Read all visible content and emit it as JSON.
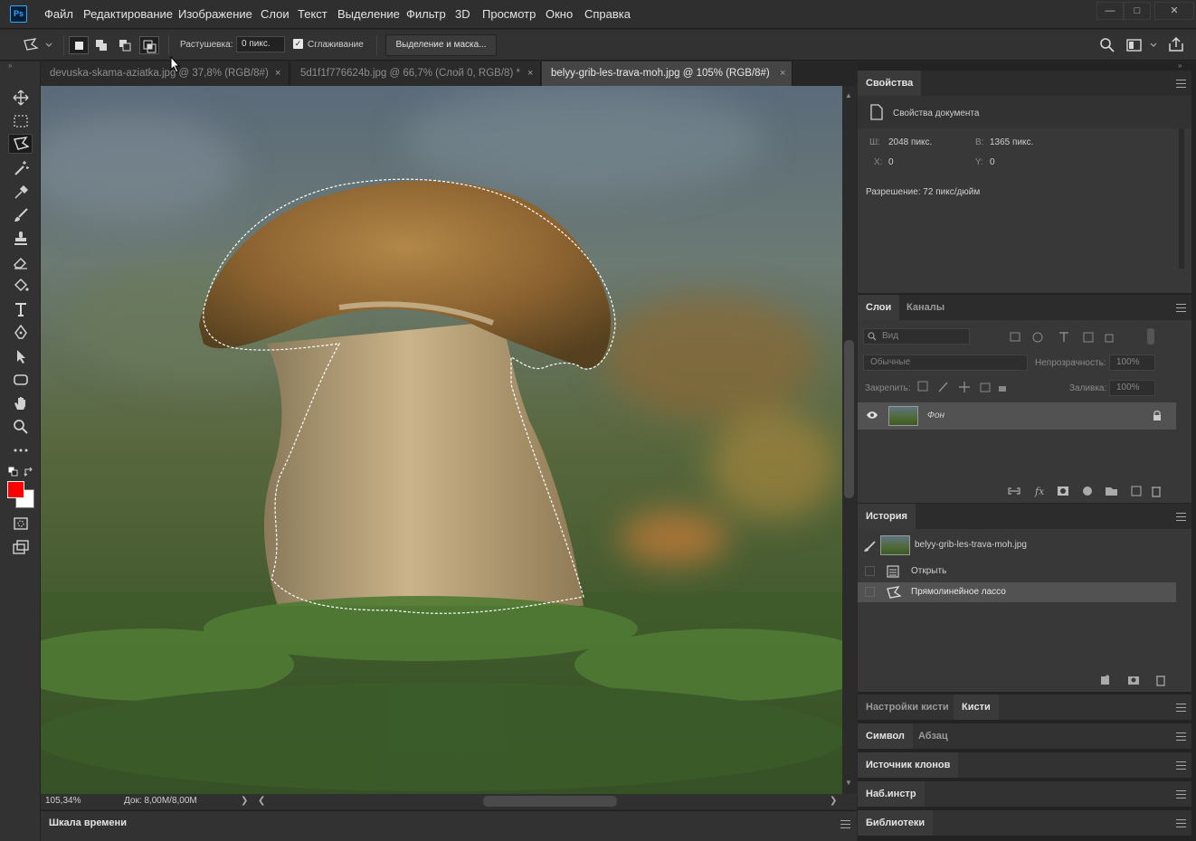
{
  "app": {
    "logo": "Ps"
  },
  "menu": [
    "Файл",
    "Редактирование",
    "Изображение",
    "Слои",
    "Текст",
    "Выделение",
    "Фильтр",
    "3D",
    "Просмотр",
    "Окно",
    "Справка"
  ],
  "window_controls": {
    "minimize": "—",
    "maximize": "□",
    "close": "✕"
  },
  "options": {
    "feather_label": "Растушевка:",
    "feather_value": "0 пикс.",
    "antialias_label": "Сглаживание",
    "antialias_checked": true,
    "select_mask_button": "Выделение и маска..."
  },
  "tabs": [
    {
      "title": "devuska-skama-aziatka.jpg @ 37,8% (RGB/8#)",
      "close": "×",
      "active": false
    },
    {
      "title": "5d1f1f776624b.jpg @ 66,7% (Слой 0, RGB/8) *",
      "close": "×",
      "active": false
    },
    {
      "title": "belyy-grib-les-trava-moh.jpg @ 105% (RGB/8#)",
      "close": "×",
      "active": true
    }
  ],
  "status": {
    "zoom": "105,34%",
    "doc": "Док: 8,00M/8,00M",
    "arrow": "❯",
    "left_arrow": "❮",
    "right_arrow": "❯"
  },
  "timeline": {
    "title": "Шкала времени"
  },
  "properties": {
    "tab": "Свойства",
    "subtitle": "Свойства документа",
    "w_label": "Ш:",
    "w_value": "2048 пикс.",
    "h_label": "В:",
    "h_value": "1365 пикс.",
    "x_label": "X:",
    "x_value": "0",
    "y_label": "Y:",
    "y_value": "0",
    "resolution": "Разрешение: 72 пикс/дюйм"
  },
  "layers": {
    "tabs": [
      "Слои",
      "Каналы"
    ],
    "filter_placeholder": "Вид",
    "blend_mode": "Обычные",
    "opacity_label": "Непрозрачность:",
    "opacity_value": "100%",
    "lock_label": "Закрепить:",
    "fill_label": "Заливка:",
    "fill_value": "100%",
    "items": [
      {
        "name": "Фон",
        "visible": true,
        "locked": true
      }
    ]
  },
  "history": {
    "tab": "История",
    "snapshot": "belyy-grib-les-trava-moh.jpg",
    "items": [
      "Открыть",
      "Прямолинейное лассо"
    ]
  },
  "collapsed_panels": [
    {
      "tabs": [
        "Настройки кисти",
        "Кисти"
      ],
      "active": 1
    },
    {
      "tabs": [
        "Символ",
        "Абзац"
      ],
      "active": 0
    },
    {
      "tabs": [
        "Источник клонов"
      ],
      "active": 0
    },
    {
      "tabs": [
        "Наб.инстр"
      ],
      "active": 0
    },
    {
      "tabs": [
        "Библиотеки"
      ],
      "active": 0
    }
  ],
  "colors": {
    "foreground": "#ff0000",
    "background": "#ffffff",
    "accent": "#31a8ff"
  }
}
